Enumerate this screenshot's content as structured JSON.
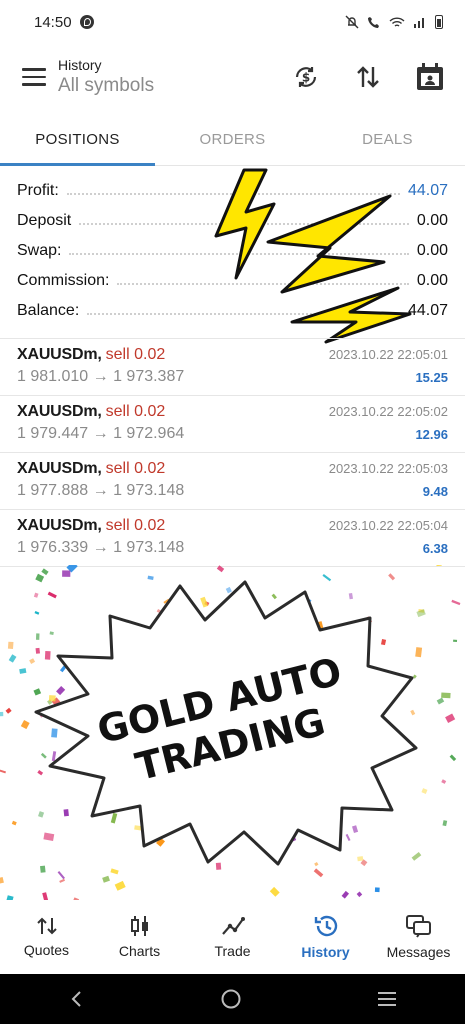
{
  "status_bar": {
    "time": "14:50"
  },
  "app_bar": {
    "section": "History",
    "filter": "All symbols",
    "icons": [
      "menu-icon",
      "sync-currency-icon",
      "sort-icon",
      "calendar-icon"
    ]
  },
  "tabs": [
    {
      "label": "POSITIONS",
      "active": true
    },
    {
      "label": "ORDERS",
      "active": false
    },
    {
      "label": "DEALS",
      "active": false
    }
  ],
  "summary": [
    {
      "label": "Profit:",
      "value": "44.07",
      "accent": true
    },
    {
      "label": "Deposit",
      "value": "0.00"
    },
    {
      "label": "Swap:",
      "value": "0.00"
    },
    {
      "label": "Commission:",
      "value": "0.00"
    },
    {
      "label": "Balance:",
      "value": "44.07"
    }
  ],
  "positions": [
    {
      "symbol": "XAUUSDm,",
      "side": "sell 0.02",
      "time": "2023.10.22 22:05:01",
      "prices": "1 981.010 → 1 973.387",
      "profit": "15.25"
    },
    {
      "symbol": "XAUUSDm,",
      "side": "sell 0.02",
      "time": "2023.10.22 22:05:02",
      "prices": "1 979.447 → 1 972.964",
      "profit": "12.96"
    },
    {
      "symbol": "XAUUSDm,",
      "side": "sell 0.02",
      "time": "2023.10.22 22:05:03",
      "prices": "1 977.888 → 1 973.148",
      "profit": "9.48"
    },
    {
      "symbol": "XAUUSDm,",
      "side": "sell 0.02",
      "time": "2023.10.22 22:05:04",
      "prices": "1 976.339 → 1 973.148",
      "profit": "6.38"
    }
  ],
  "overlay": {
    "line1": "GOLD AUTO",
    "line2": "TRADING"
  },
  "bottom_nav": [
    {
      "label": "Quotes",
      "icon": "quotes-icon",
      "active": false
    },
    {
      "label": "Charts",
      "icon": "charts-icon",
      "active": false
    },
    {
      "label": "Trade",
      "icon": "trade-icon",
      "active": false
    },
    {
      "label": "History",
      "icon": "history-icon",
      "active": true
    },
    {
      "label": "Messages",
      "icon": "messages-icon",
      "active": false
    }
  ],
  "colors": {
    "accent": "#2a6fc0",
    "sell": "#c0392b",
    "muted": "#8a8a8a",
    "lightning": "#ffe100"
  }
}
